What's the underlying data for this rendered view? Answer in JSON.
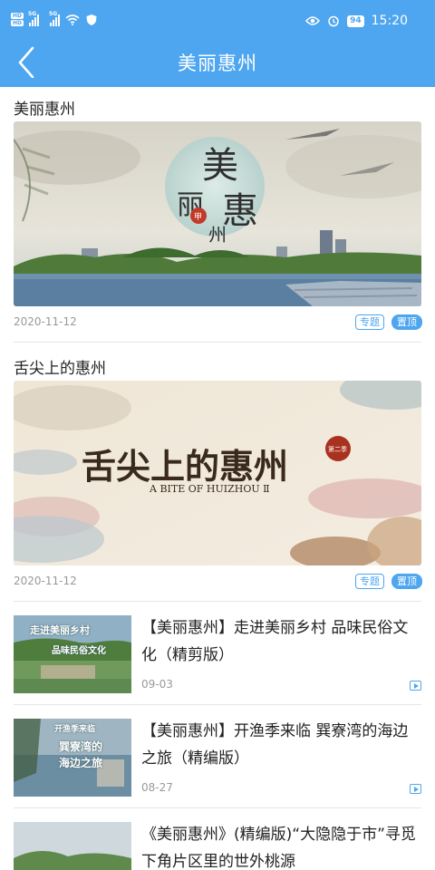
{
  "status": {
    "hd1": "HD",
    "hd2": "HD",
    "sig1": "5G",
    "sig2": "5G",
    "battery": "94",
    "time": "15:20"
  },
  "nav": {
    "title": "美丽惠州"
  },
  "cards": [
    {
      "title": "美丽惠州",
      "date": "2020-11-12",
      "tag_topic": "专题",
      "tag_pinned": "置顶",
      "art": {
        "calligraphy": [
          "美",
          "丽",
          "惠",
          "州"
        ],
        "seal": "甲"
      }
    },
    {
      "title": "舌尖上的惠州",
      "date": "2020-11-12",
      "tag_topic": "专题",
      "tag_pinned": "置顶",
      "art": {
        "headline": "舌尖上的惠州",
        "english": "A BITE OF HUIZHOU Ⅱ",
        "season": "第二季"
      }
    }
  ],
  "list": [
    {
      "title": "【美丽惠州】走进美丽乡村 品味民俗文化（精剪版）",
      "date": "09-03",
      "thumb_line1": "走进美丽乡村",
      "thumb_line2": "品味民俗文化"
    },
    {
      "title": "【美丽惠州】开渔季来临 巽寮湾的海边之旅（精编版）",
      "date": "08-27",
      "thumb_line1": "开渔季来临",
      "thumb_line2": "巽寮湾的",
      "thumb_line3": "海边之旅"
    },
    {
      "title": "《美丽惠州》(精编版)“大隐隐于市”寻觅下角片区里的世外桃源",
      "date": ""
    }
  ],
  "colors": {
    "accent": "#4da6ef",
    "date_gray": "#999999",
    "divider": "#e6e6e6"
  }
}
